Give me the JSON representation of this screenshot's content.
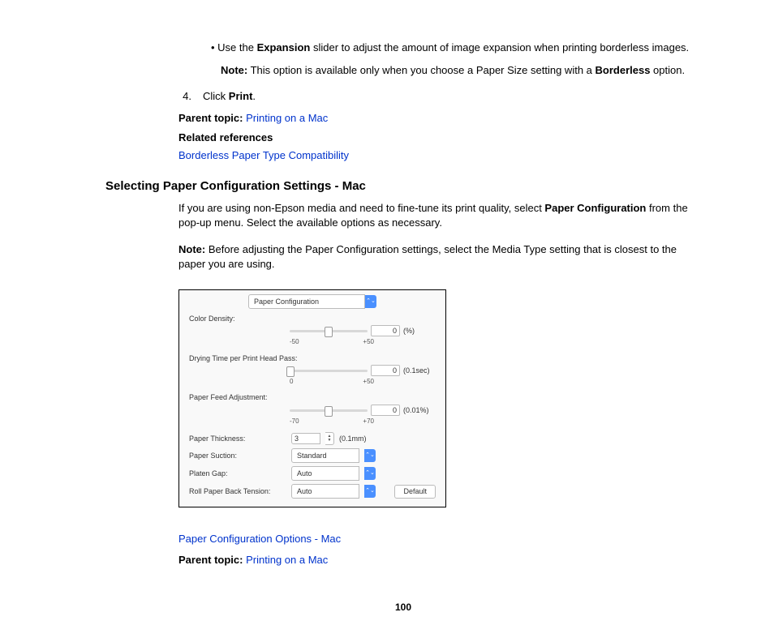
{
  "section1": {
    "bullet_pre": "Use the ",
    "bullet_bold": "Expansion",
    "bullet_post": " slider to adjust the amount of image expansion when printing borderless images.",
    "note_label": "Note:",
    "note_pre": " This option is available only when you choose a Paper Size setting with a ",
    "note_bold": "Borderless",
    "note_post": " option.",
    "step_num": "4.",
    "step_pre": "Click ",
    "step_bold": "Print",
    "step_post": ".",
    "parent_label": "Parent topic:",
    "parent_link": "Printing on a Mac",
    "related_label": "Related references",
    "related_link": "Borderless Paper Type Compatibility"
  },
  "heading": "Selecting Paper Configuration Settings - Mac",
  "section2": {
    "p1_pre": "If you are using non-Epson media and need to fine-tune its print quality, select ",
    "p1_bold": "Paper Configuration",
    "p1_post": " from the pop-up menu. Select the available options as necessary.",
    "note_label": "Note:",
    "note_text": " Before adjusting the Paper Configuration settings, select the Media Type setting that is closest to the paper you are using."
  },
  "dialog": {
    "menu": "Paper Configuration",
    "rows": {
      "color_density": {
        "label": "Color Density:",
        "value": "0",
        "unit": "(%)",
        "min": "-50",
        "max": "+50",
        "pos": 50
      },
      "drying_time": {
        "label": "Drying Time per Print Head Pass:",
        "value": "0",
        "unit": "(0.1sec)",
        "min": "0",
        "max": "+50",
        "pos": 1
      },
      "paper_feed": {
        "label": "Paper Feed Adjustment:",
        "value": "0",
        "unit": "(0.01%)",
        "min": "-70",
        "max": "+70",
        "pos": 50
      },
      "thickness": {
        "label": "Paper Thickness:",
        "value": "3",
        "unit": "(0.1mm)"
      },
      "suction": {
        "label": "Paper Suction:",
        "value": "Standard"
      },
      "platen": {
        "label": "Platen Gap:",
        "value": "Auto"
      },
      "roll_tension": {
        "label": "Roll Paper Back Tension:",
        "value": "Auto"
      }
    },
    "default_btn": "Default"
  },
  "section3": {
    "config_link": "Paper Configuration Options - Mac",
    "parent_label": "Parent topic:",
    "parent_link": "Printing on a Mac"
  },
  "page_number": "100"
}
